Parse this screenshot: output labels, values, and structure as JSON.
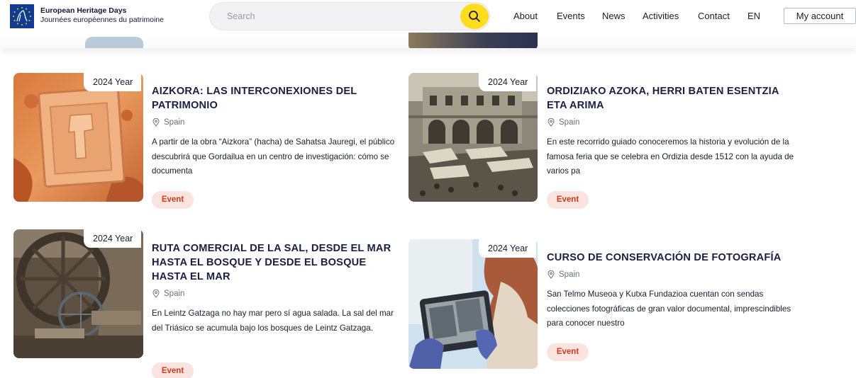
{
  "header": {
    "brand_title": "European Heritage Days",
    "brand_subtitle": "Journées européennes du patrimoine",
    "search_placeholder": "Search",
    "nav": [
      "About",
      "Events",
      "News",
      "Activities",
      "Contact",
      "EN"
    ],
    "account_label": "My account"
  },
  "colors": {
    "accent_yellow": "#ffdc1e",
    "badge_bg": "#fbe4df",
    "badge_text": "#cf3b1c",
    "brand_blue": "#123c91"
  },
  "cards": [
    {
      "year": "2024 Year",
      "title": "AIZKORA: LAS INTERCONEXIONES DEL PATRIMONIO",
      "location": "Spain",
      "description": "A partir de la obra “Aizkora” (hacha) de Sahatsa Jauregi, el público descubrirá que Gordailua en un centro de investigación: cómo se documenta",
      "badge": "Event"
    },
    {
      "year": "2024 Year",
      "title": "ORDIZIAKO AZOKA, HERRI BATEN ESENTZIA ETA ARIMA",
      "location": "Spain",
      "description": "En este recorrido guiado conoceremos la historia y evolución de la famosa feria que se celebra en Ordizia desde 1512 con la ayuda de varios pa",
      "badge": "Event"
    },
    {
      "year": "2024 Year",
      "title": "RUTA COMERCIAL DE LA SAL, DESDE EL MAR HASTA EL BOSQUE Y DESDE EL BOSQUE HASTA EL MAR",
      "location": "Spain",
      "description": "En Leintz Gatzaga no hay mar pero sí agua salada. La sal del mar del Triásico se acumula bajo los bosques de Leintz Gatzaga.",
      "badge": "Event"
    },
    {
      "year": "2024 Year",
      "title": "CURSO DE CONSERVACIÓN DE FOTOGRAFÍA",
      "location": "Spain",
      "description": "San Telmo Museoa y Kutxa Fundazioa cuentan con sendas colecciones fotográficas de gran valor documental, imprescindibles para conocer nuestro",
      "badge": "Event"
    }
  ]
}
